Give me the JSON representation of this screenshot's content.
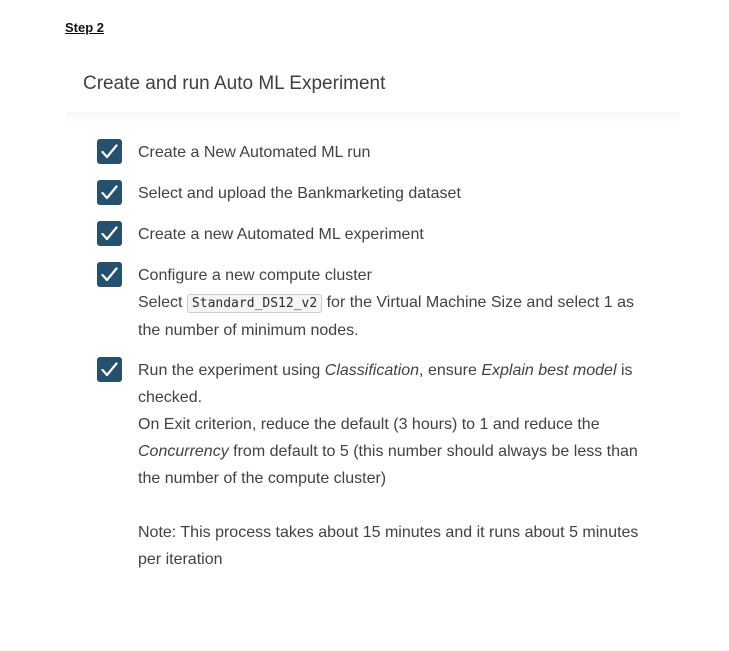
{
  "step_label": "Step 2",
  "section_title": "Create and run Auto ML Experiment",
  "tasks": [
    {
      "checked": true,
      "text": "Create a New Automated ML run"
    },
    {
      "checked": true,
      "text": "Select and upload the Bankmarketing dataset"
    },
    {
      "checked": true,
      "text": "Create a new Automated ML experiment"
    },
    {
      "checked": true,
      "line1": "Configure a new compute cluster",
      "line2_prefix": "Select",
      "code": "Standard_DS12_v2",
      "line2_suffix": "for the Virtual Machine Size and select 1 as the number of minimum nodes."
    },
    {
      "checked": true,
      "p1_a": "Run the experiment using ",
      "p1_em1": "Classification",
      "p1_b": ", ensure ",
      "p1_em2": "Explain best model",
      "p1_c": " is checked.",
      "p2_a": "On Exit criterion, reduce the default (3 hours) to 1 and reduce the ",
      "p2_em": "Concurrency",
      "p2_b": " from default to 5 (this number should always be less than the number of the compute cluster)",
      "note": "Note: This process takes about 15 minutes and it runs about 5 minutes per iteration"
    }
  ],
  "colors": {
    "checkbox": "#25506e",
    "text": "#3f4246"
  },
  "icons": {
    "checkbox": "checkmark-icon"
  }
}
